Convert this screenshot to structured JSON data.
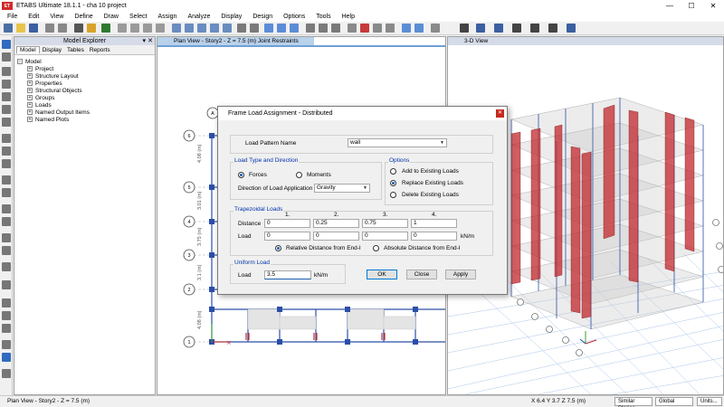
{
  "window": {
    "app_badge": "ET",
    "title": "ETABS Ultimate 18.1.1 - cha 10 project",
    "minimize": "—",
    "maximize": "☐",
    "close": "✕"
  },
  "menu": [
    "File",
    "Edit",
    "View",
    "Define",
    "Draw",
    "Select",
    "Assign",
    "Analyze",
    "Display",
    "Design",
    "Options",
    "Tools",
    "Help"
  ],
  "explorer": {
    "title": "Model Explorer",
    "tabs": [
      "Model",
      "Display",
      "Tables",
      "Reports"
    ],
    "root": "Model",
    "items": [
      "Project",
      "Structure Layout",
      "Properties",
      "Structural Objects",
      "Groups",
      "Loads",
      "Named Output Items",
      "Named Plots"
    ]
  },
  "plan_view": {
    "tab_title": "Plan View - Story2 - Z = 7.5 (m)  Joint Restraints",
    "grid_bubbles": [
      "A",
      "6",
      "5",
      "4",
      "3",
      "2",
      "1"
    ],
    "dims": [
      "4.08 (m)",
      "3.01 (m)",
      "3.75 (m)",
      "3.1 (m)",
      "4.08 (m)"
    ]
  },
  "view3d": {
    "tab_title": "3-D View"
  },
  "dialog": {
    "title": "Frame Load Assignment - Distributed",
    "close_glyph": "✕",
    "load_pattern_label": "Load Pattern Name",
    "load_pattern_value": "wall",
    "type_group": "Load Type and Direction",
    "forces": "Forces",
    "moments": "Moments",
    "direction_label": "Direction of Load Application",
    "direction_value": "Gravity",
    "options_group": "Options",
    "opt_add": "Add to Existing Loads",
    "opt_replace": "Replace Existing Loads",
    "opt_delete": "Delete Existing Loads",
    "trap_group": "Trapezoidal Loads",
    "col_numbers": [
      "1.",
      "2.",
      "3.",
      "4."
    ],
    "distance_label": "Distance",
    "distances": [
      "0",
      "0.25",
      "0.75",
      "1"
    ],
    "load_label": "Load",
    "loads": [
      "0",
      "0",
      "0",
      "0"
    ],
    "load_unit": "kN/m",
    "rel_dist": "Relative Distance from End-I",
    "abs_dist": "Absolute Distance from End-I",
    "uniform_group": "Uniform Load",
    "uniform_label": "Load",
    "uniform_value": "3.5",
    "uniform_unit": "kN/m",
    "ok": "OK",
    "close": "Close",
    "apply": "Apply"
  },
  "status": {
    "left": "Plan View - Story2 - Z = 7.5 (m)",
    "coords": "X 6.4  Y 3.7  Z 7.5 (m)",
    "stories": "Similar Stories",
    "coord_sys": "Global",
    "units": "Units..."
  },
  "colors": {
    "accent": "#1a5fb4",
    "brace_red": "#c0282d",
    "grid_blue": "#6f9fd8"
  }
}
